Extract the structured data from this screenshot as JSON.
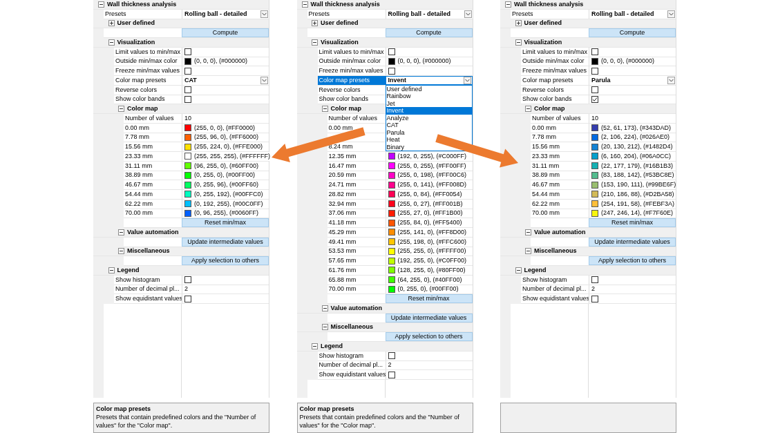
{
  "panels": [
    {
      "tree": [
        {
          "kind": "group",
          "label": "Wall thickness analysis",
          "expanded": true,
          "children": [
            {
              "kind": "dropdown",
              "label": "Presets",
              "value": "Rolling ball - detailed",
              "open": false
            },
            {
              "kind": "group",
              "label": "User defined",
              "expanded": false
            },
            {
              "kind": "button",
              "label": "Compute"
            },
            {
              "kind": "group",
              "label": "Visualization",
              "expanded": true,
              "children": [
                {
                  "kind": "checkbox",
                  "label": "Limit values to min/max",
                  "checked": false
                },
                {
                  "kind": "color",
                  "label": "Outside min/max color",
                  "color": "#000000",
                  "value": "(0, 0, 0), (#000000)"
                },
                {
                  "kind": "checkbox",
                  "label": "Freeze min/max values",
                  "checked": false
                },
                {
                  "kind": "dropdown",
                  "label": "Color map presets",
                  "value": "CAT",
                  "open": false
                },
                {
                  "kind": "checkbox",
                  "label": "Reverse colors",
                  "checked": false
                },
                {
                  "kind": "checkbox",
                  "label": "Show color bands",
                  "checked": false
                },
                {
                  "kind": "group",
                  "label": "Color map",
                  "expanded": true,
                  "children": [
                    {
                      "kind": "text",
                      "label": "Number of values",
                      "value": "10"
                    },
                    {
                      "kind": "color",
                      "label": "0.00 mm",
                      "color": "#ff0000",
                      "value": "(255, 0, 0), (#FF0000)"
                    },
                    {
                      "kind": "color",
                      "label": "7.78 mm",
                      "color": "#ff6000",
                      "value": "(255, 96, 0), (#FF6000)"
                    },
                    {
                      "kind": "color",
                      "label": "15.56 mm",
                      "color": "#ffe000",
                      "value": "(255, 224, 0), (#FFE000)"
                    },
                    {
                      "kind": "color",
                      "label": "23.33 mm",
                      "color": "#ffffff",
                      "value": "(255, 255, 255), (#FFFFFF)"
                    },
                    {
                      "kind": "color",
                      "label": "31.11 mm",
                      "color": "#60ff00",
                      "value": "(96, 255, 0), (#60FF00)"
                    },
                    {
                      "kind": "color",
                      "label": "38.89 mm",
                      "color": "#00ff00",
                      "value": "(0, 255, 0), (#00FF00)"
                    },
                    {
                      "kind": "color",
                      "label": "46.67 mm",
                      "color": "#00ff60",
                      "value": "(0, 255, 96), (#00FF60)"
                    },
                    {
                      "kind": "color",
                      "label": "54.44 mm",
                      "color": "#00ffc0",
                      "value": "(0, 255, 192), (#00FFC0)"
                    },
                    {
                      "kind": "color",
                      "label": "62.22 mm",
                      "color": "#00c0ff",
                      "value": "(0, 192, 255), (#00C0FF)"
                    },
                    {
                      "kind": "color",
                      "label": "70.00 mm",
                      "color": "#0060ff",
                      "value": "(0, 96, 255), (#0060FF)"
                    },
                    {
                      "kind": "button",
                      "label": "Reset min/max"
                    }
                  ]
                },
                {
                  "kind": "group",
                  "label": "Value automation",
                  "expanded": true,
                  "children": [
                    {
                      "kind": "button",
                      "label": "Update intermediate values"
                    }
                  ]
                },
                {
                  "kind": "group",
                  "label": "Miscellaneous",
                  "expanded": true,
                  "children": [
                    {
                      "kind": "button",
                      "label": "Apply selection to others"
                    }
                  ]
                }
              ]
            },
            {
              "kind": "group",
              "label": "Legend",
              "expanded": true,
              "children": [
                {
                  "kind": "checkbox",
                  "label": "Show histogram",
                  "checked": false
                },
                {
                  "kind": "text",
                  "label": "Number of decimal pl...",
                  "value": "2"
                },
                {
                  "kind": "checkbox",
                  "label": "Show equidistant values",
                  "checked": false
                }
              ]
            }
          ]
        }
      ],
      "description": {
        "title": "Color map presets",
        "text": "Presets that contain predefined colors and the \"Number of values\" for the \"Color map\"."
      }
    },
    {
      "tree": [
        {
          "kind": "group",
          "label": "Wall thickness analysis",
          "expanded": true,
          "children": [
            {
              "kind": "dropdown",
              "label": "Presets",
              "value": "Rolling ball - detailed",
              "open": false
            },
            {
              "kind": "group",
              "label": "User defined",
              "expanded": false
            },
            {
              "kind": "button",
              "label": "Compute"
            },
            {
              "kind": "group",
              "label": "Visualization",
              "expanded": true,
              "children": [
                {
                  "kind": "checkbox",
                  "label": "Limit values to min/max",
                  "checked": false
                },
                {
                  "kind": "color",
                  "label": "Outside min/max color",
                  "color": "#000000",
                  "value": "(0, 0, 0), (#000000)"
                },
                {
                  "kind": "checkbox",
                  "label": "Freeze min/max values",
                  "checked": false
                },
                {
                  "kind": "dropdown",
                  "label": "Color map presets",
                  "value": "Invent",
                  "open": true,
                  "options": [
                    {
                      "label": "User defined",
                      "selected": false
                    },
                    {
                      "label": "Rainbow",
                      "selected": false
                    },
                    {
                      "label": "Jet",
                      "selected": false
                    },
                    {
                      "label": "Invent",
                      "selected": true
                    },
                    {
                      "label": "Analyze",
                      "selected": false
                    },
                    {
                      "label": "CAT",
                      "selected": false
                    },
                    {
                      "label": "Parula",
                      "selected": false
                    },
                    {
                      "label": "Heat",
                      "selected": false
                    },
                    {
                      "label": "Binary",
                      "selected": false
                    }
                  ]
                },
                {
                  "kind": "checkbox",
                  "label": "Reverse colors"
                },
                {
                  "kind": "checkbox",
                  "label": "Show color bands"
                },
                {
                  "kind": "group",
                  "label": "Color map",
                  "expanded": true,
                  "children": [
                    {
                      "kind": "text",
                      "label": "Number of values"
                    },
                    {
                      "kind": "color",
                      "label": "0.00 mm"
                    },
                    {
                      "kind": "color"
                    },
                    {
                      "kind": "color",
                      "label": "8.24 mm"
                    },
                    {
                      "kind": "color",
                      "label": "12.35 mm",
                      "color": "#c000ff",
                      "value": "(192, 0, 255), (#C000FF)"
                    },
                    {
                      "kind": "color",
                      "label": "16.47 mm",
                      "color": "#ff00ff",
                      "value": "(255, 0, 255), (#FF00FF)"
                    },
                    {
                      "kind": "color",
                      "label": "20.59 mm",
                      "color": "#ff00c6",
                      "value": "(255, 0, 198), (#FF00C6)"
                    },
                    {
                      "kind": "color",
                      "label": "24.71 mm",
                      "color": "#ff008d",
                      "value": "(255, 0, 141), (#FF008D)"
                    },
                    {
                      "kind": "color",
                      "label": "28.82 mm",
                      "color": "#ff0054",
                      "value": "(255, 0, 84), (#FF0054)"
                    },
                    {
                      "kind": "color",
                      "label": "32.94 mm",
                      "color": "#ff001b",
                      "value": "(255, 0, 27), (#FF001B)"
                    },
                    {
                      "kind": "color",
                      "label": "37.06 mm",
                      "color": "#ff1b00",
                      "value": "(255, 27, 0), (#FF1B00)"
                    },
                    {
                      "kind": "color",
                      "label": "41.18 mm",
                      "color": "#ff5400",
                      "value": "(255, 84, 0), (#FF5400)"
                    },
                    {
                      "kind": "color",
                      "label": "45.29 mm",
                      "color": "#ff8d00",
                      "value": "(255, 141, 0), (#FF8D00)"
                    },
                    {
                      "kind": "color",
                      "label": "49.41 mm",
                      "color": "#ffc600",
                      "value": "(255, 198, 0), (#FFC600)"
                    },
                    {
                      "kind": "color",
                      "label": "53.53 mm",
                      "color": "#ffff00",
                      "value": "(255, 255, 0), (#FFFF00)"
                    },
                    {
                      "kind": "color",
                      "label": "57.65 mm",
                      "color": "#c0ff00",
                      "value": "(192, 255, 0), (#C0FF00)"
                    },
                    {
                      "kind": "color",
                      "label": "61.76 mm",
                      "color": "#80ff00",
                      "value": "(128, 255, 0), (#80FF00)"
                    },
                    {
                      "kind": "color",
                      "label": "65.88 mm",
                      "color": "#40ff00",
                      "value": "(64, 255, 0), (#40FF00)"
                    },
                    {
                      "kind": "color",
                      "label": "70.00 mm",
                      "color": "#00ff00",
                      "value": "(0, 255, 0), (#00FF00)"
                    },
                    {
                      "kind": "button",
                      "label": "Reset min/max"
                    }
                  ]
                },
                {
                  "kind": "group",
                  "label": "Value automation",
                  "expanded": true,
                  "children": [
                    {
                      "kind": "button",
                      "label": "Update intermediate values"
                    }
                  ]
                },
                {
                  "kind": "group",
                  "label": "Miscellaneous",
                  "expanded": true,
                  "children": [
                    {
                      "kind": "button",
                      "label": "Apply selection to others"
                    }
                  ]
                }
              ]
            },
            {
              "kind": "group",
              "label": "Legend",
              "expanded": true,
              "children": [
                {
                  "kind": "checkbox",
                  "label": "Show histogram",
                  "checked": false
                },
                {
                  "kind": "text",
                  "label": "Number of decimal pl...",
                  "value": "2"
                },
                {
                  "kind": "checkbox",
                  "label": "Show equidistant values",
                  "checked": false
                }
              ]
            }
          ]
        }
      ],
      "description": {
        "title": "Color map presets",
        "text": "Presets that contain predefined colors and the \"Number of values\" for the \"Color map\"."
      }
    },
    {
      "tree": [
        {
          "kind": "group",
          "label": "Wall thickness analysis",
          "expanded": true,
          "children": [
            {
              "kind": "dropdown",
              "label": "Presets",
              "value": "Rolling ball - detailed",
              "open": false
            },
            {
              "kind": "group",
              "label": "User defined",
              "expanded": false
            },
            {
              "kind": "button",
              "label": "Compute"
            },
            {
              "kind": "group",
              "label": "Visualization",
              "expanded": true,
              "children": [
                {
                  "kind": "checkbox",
                  "label": "Limit values to min/max",
                  "checked": false
                },
                {
                  "kind": "color",
                  "label": "Outside min/max color",
                  "color": "#000000",
                  "value": "(0, 0, 0), (#000000)"
                },
                {
                  "kind": "checkbox",
                  "label": "Freeze min/max values",
                  "checked": false
                },
                {
                  "kind": "dropdown",
                  "label": "Color map presets",
                  "value": "Parula",
                  "open": false
                },
                {
                  "kind": "checkbox",
                  "label": "Reverse colors",
                  "checked": false
                },
                {
                  "kind": "checkbox",
                  "label": "Show color bands",
                  "checked": true
                },
                {
                  "kind": "group",
                  "label": "Color map",
                  "expanded": true,
                  "children": [
                    {
                      "kind": "text",
                      "label": "Number of values",
                      "value": "10"
                    },
                    {
                      "kind": "color",
                      "label": "0.00 mm",
                      "color": "#343dad",
                      "value": "(52, 61, 173), (#343DAD)"
                    },
                    {
                      "kind": "color",
                      "label": "7.78 mm",
                      "color": "#026ae0",
                      "value": "(2, 106, 224), (#026AE0)"
                    },
                    {
                      "kind": "color",
                      "label": "15.56 mm",
                      "color": "#1482d4",
                      "value": "(20, 130, 212), (#1482D4)"
                    },
                    {
                      "kind": "color",
                      "label": "23.33 mm",
                      "color": "#06a0cc",
                      "value": "(6, 160, 204), (#06A0CC)"
                    },
                    {
                      "kind": "color",
                      "label": "31.11 mm",
                      "color": "#16b1b3",
                      "value": "(22, 177, 179), (#16B1B3)"
                    },
                    {
                      "kind": "color",
                      "label": "38.89 mm",
                      "color": "#53bc8e",
                      "value": "(83, 188, 142), (#53BC8E)"
                    },
                    {
                      "kind": "color",
                      "label": "46.67 mm",
                      "color": "#99be6f",
                      "value": "(153, 190, 111), (#99BE6F)"
                    },
                    {
                      "kind": "color",
                      "label": "54.44 mm",
                      "color": "#d2ba58",
                      "value": "(210, 186, 88), (#D2BA58)"
                    },
                    {
                      "kind": "color",
                      "label": "62.22 mm",
                      "color": "#febf3a",
                      "value": "(254, 191, 58), (#FEBF3A)"
                    },
                    {
                      "kind": "color",
                      "label": "70.00 mm",
                      "color": "#f7f60e",
                      "value": "(247, 246, 14), (#F7F60E)"
                    },
                    {
                      "kind": "button",
                      "label": "Reset min/max"
                    }
                  ]
                },
                {
                  "kind": "group",
                  "label": "Value automation",
                  "expanded": true,
                  "children": [
                    {
                      "kind": "button",
                      "label": "Update intermediate values"
                    }
                  ]
                },
                {
                  "kind": "group",
                  "label": "Miscellaneous",
                  "expanded": true,
                  "children": [
                    {
                      "kind": "button",
                      "label": "Apply selection to others"
                    }
                  ]
                }
              ]
            },
            {
              "kind": "group",
              "label": "Legend",
              "expanded": true,
              "children": [
                {
                  "kind": "checkbox",
                  "label": "Show histogram",
                  "checked": false
                },
                {
                  "kind": "text",
                  "label": "Number of decimal pl...",
                  "value": "2"
                },
                {
                  "kind": "checkbox",
                  "label": "Show equidistant values",
                  "checked": false
                }
              ]
            }
          ]
        }
      ]
    }
  ]
}
